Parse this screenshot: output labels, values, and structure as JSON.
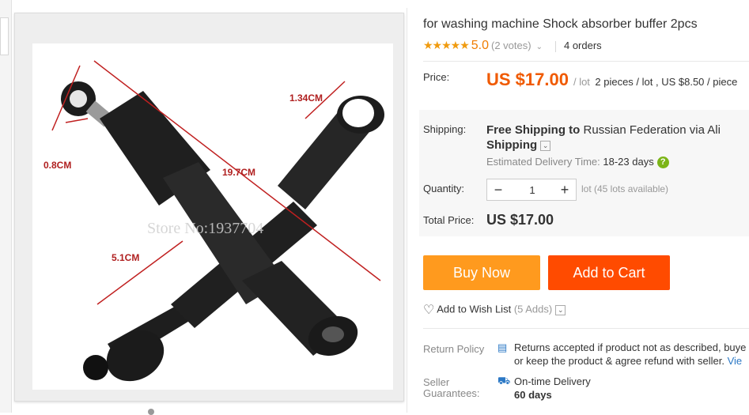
{
  "product": {
    "title": "for washing machine Shock absorber buffer 2pcs",
    "rating": "5.0",
    "stars": "★★★★★",
    "votes": "(2 votes)",
    "orders": "4 orders"
  },
  "gallery": {
    "watermark": "Store No:1937704",
    "dimensions": [
      "1.34CM",
      "0.8CM",
      "19.7CM",
      "5.1CM"
    ]
  },
  "price": {
    "label": "Price:",
    "value": "US $17.00",
    "unit": "/ lot",
    "note": "2 pieces / lot , US $8.50 / piece"
  },
  "shipping": {
    "label": "Shipping:",
    "free": "Free Shipping to",
    "destination": "Russian Federation via Ali",
    "method": "Shipping",
    "estimated_label": "Estimated Delivery Time:",
    "estimated_days": "18-23  days"
  },
  "quantity": {
    "label": "Quantity:",
    "value": "1",
    "available": "lot (45 lots available)"
  },
  "total": {
    "label": "Total Price:",
    "value": "US $17.00"
  },
  "actions": {
    "buy_now": "Buy Now",
    "add_to_cart": "Add to Cart",
    "wish_list": "Add to Wish List",
    "wish_count": "(5 Adds)"
  },
  "return_policy": {
    "label": "Return Policy",
    "line1": "Returns accepted if product not as described, buye",
    "line2": "or keep the product & agree refund with seller.",
    "link": "Vie"
  },
  "seller": {
    "label_line1": "Seller",
    "label_line2": "Guarantees:",
    "ontime": "On-time Delivery",
    "days": "60 days"
  },
  "colors": {
    "price": "#f05a00",
    "buy_now": "#ff9a1e",
    "add_to_cart": "#ff4b00",
    "star": "#f09b0f",
    "help": "#7cb518"
  },
  "icons": [
    "heart-icon",
    "help-icon",
    "return-policy-icon",
    "delivery-truck-icon",
    "chevron-down-icon"
  ]
}
